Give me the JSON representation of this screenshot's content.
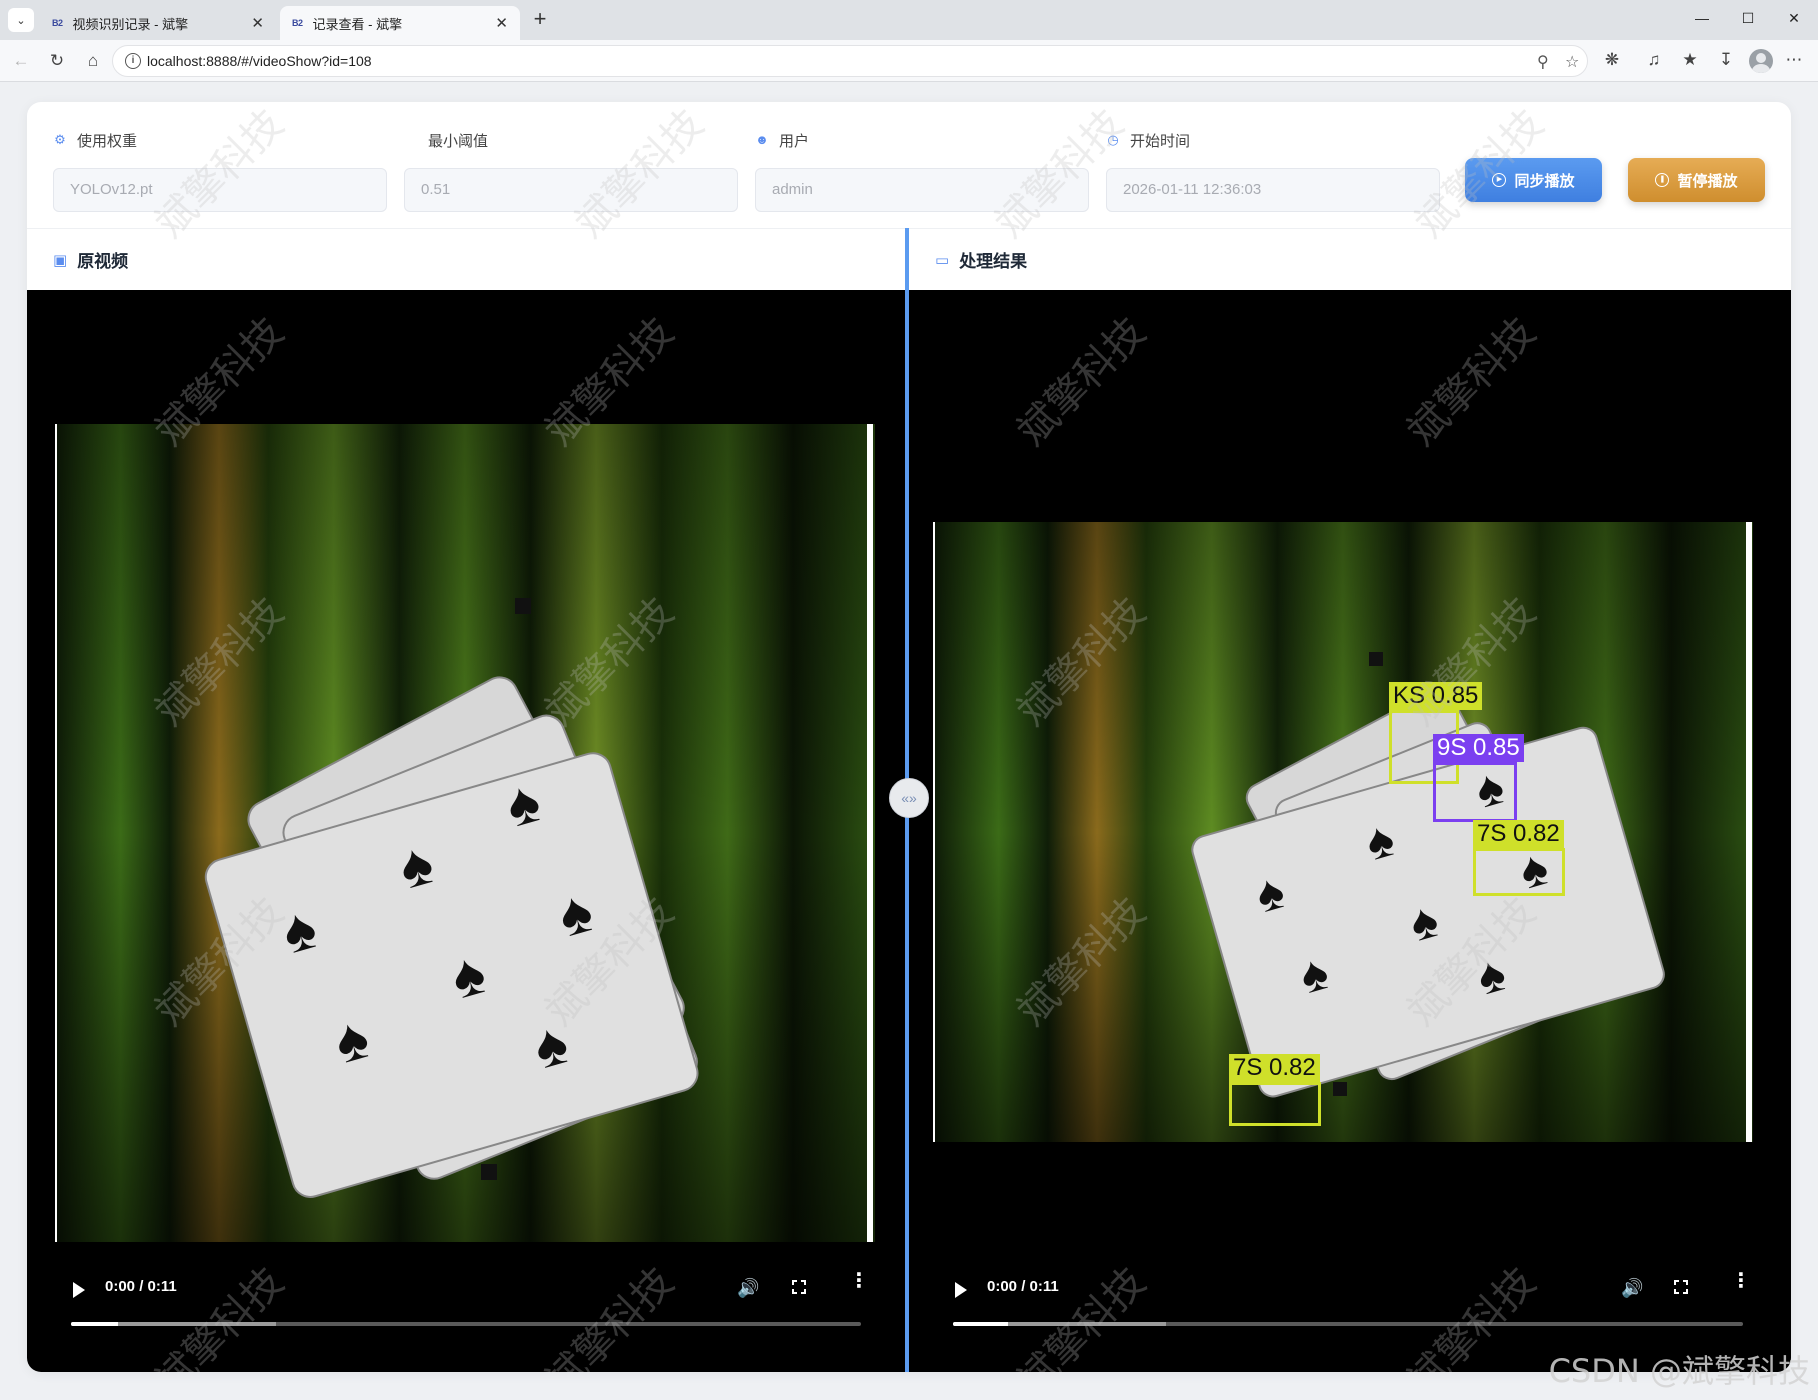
{
  "browser": {
    "tabs": [
      {
        "favicon": "B2",
        "title": "视频识别记录 - 斌擎"
      },
      {
        "favicon": "B2",
        "title": "记录查看 - 斌擎"
      }
    ],
    "url": "localhost:8888/#/videoShow?id=108"
  },
  "filters": {
    "weight_label": "使用权重",
    "weight_value": "YOLOv12.pt",
    "threshold_label": "最小阈值",
    "threshold_value": "0.51",
    "user_label": "用户",
    "user_value": "admin",
    "start_label": "开始时间",
    "start_value": "2026-01-11 12:36:03",
    "sync_button": "同步播放",
    "pause_button": "暂停播放"
  },
  "panels": {
    "original_title": "原视频",
    "result_title": "处理结果"
  },
  "player_left": {
    "time": "0:00 / 0:11",
    "played_fraction": 0.06,
    "buffered_fraction": 0.26
  },
  "player_right": {
    "time": "0:00 / 0:11",
    "played_fraction": 0.07,
    "buffered_fraction": 0.27
  },
  "detections": [
    {
      "label": "KS 0.85",
      "color": "#cfe02a"
    },
    {
      "label": "9S 0.85",
      "color": "#7b3ff0"
    },
    {
      "label": "7S 0.82",
      "color": "#cfe02a"
    },
    {
      "label": "7S 0.82",
      "color": "#cfe02a"
    }
  ],
  "watermark": "斌擎科技",
  "footer_credit": "CSDN @斌擎科技",
  "colors": {
    "accent": "#5b9bf0",
    "sync_button": "#4a8ae6",
    "pause_button": "#d99a3c"
  }
}
